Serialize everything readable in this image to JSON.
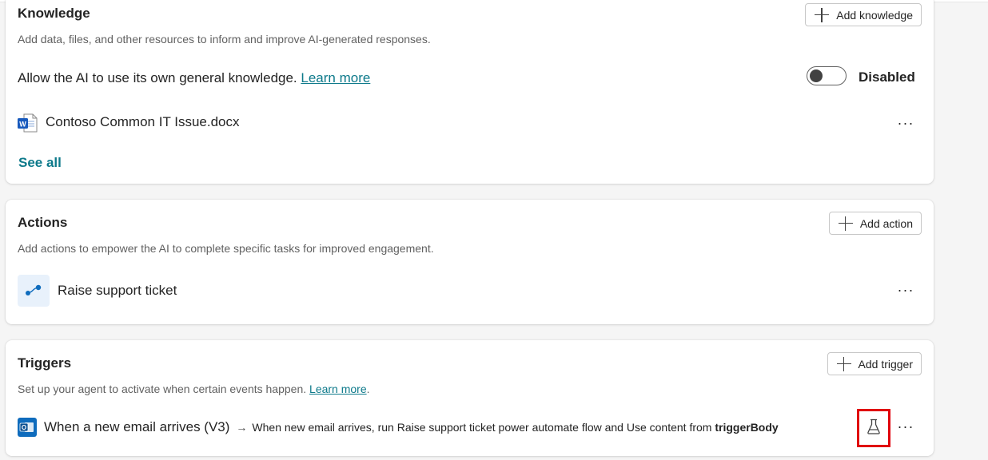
{
  "knowledge": {
    "title": "Knowledge",
    "add_label": "Add knowledge",
    "description": "Add data, files, and other resources to inform and improve AI-generated responses.",
    "general_knowledge_text": "Allow the AI to use its own general knowledge.",
    "learn_more": "Learn more",
    "toggle_state": "Disabled",
    "file_name": "Contoso Common IT Issue.docx",
    "file_icon": "word-doc-icon",
    "see_all": "See all"
  },
  "actions": {
    "title": "Actions",
    "add_label": "Add action",
    "description": "Add actions to empower the AI to complete specific tasks for improved engagement.",
    "items": [
      {
        "label": "Raise support ticket",
        "icon": "flow-icon"
      }
    ]
  },
  "triggers": {
    "title": "Triggers",
    "add_label": "Add trigger",
    "description": "Set up your agent to activate when certain events happen.",
    "learn_more": "Learn more",
    "description_suffix": ".",
    "items": [
      {
        "name": "When a new email arrives (V3)",
        "icon": "outlook-icon",
        "arrow": "→",
        "desc_prefix": "When new email arrives, run Raise support ticket power automate flow and Use content from ",
        "desc_bold": "triggerBody"
      }
    ]
  },
  "more_glyph": "···",
  "colors": {
    "accent": "#0f6cbd",
    "link_teal": "#0e7a8b",
    "highlight": "#e0000b"
  }
}
